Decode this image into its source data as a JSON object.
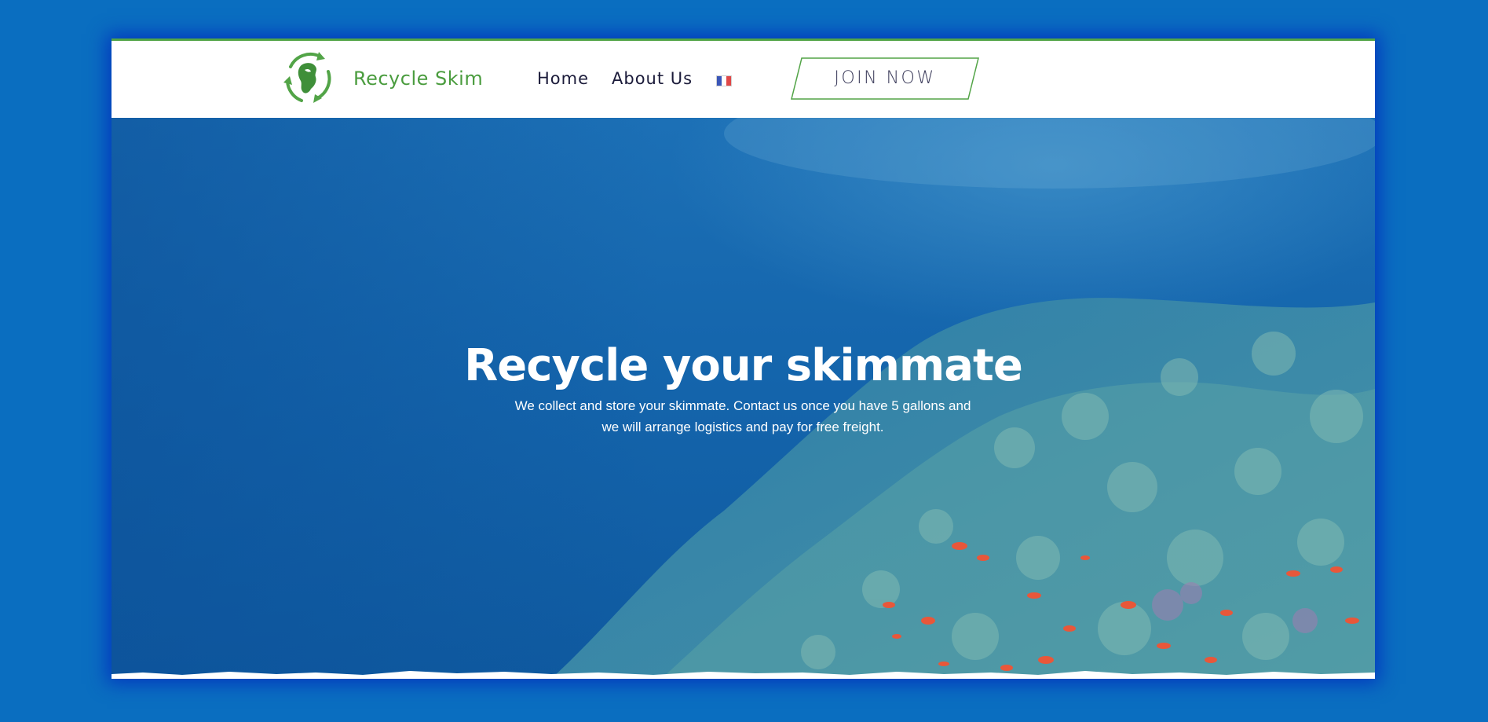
{
  "header": {
    "brand": "Recycle Skim",
    "nav": {
      "home": "Home",
      "about": "About Us"
    },
    "language_icon": "french-flag-icon",
    "join_button": "JOIN NOW"
  },
  "hero": {
    "title": "Recycle your skimmate",
    "subtitle": "We collect and store your skimmate. Contact us once you have 5 gallons and we will arrange logistics and pay for free freight."
  },
  "colors": {
    "page_background": "#0a6ec0",
    "brand_green": "#4a9c3e",
    "nav_text": "#1b1b3a",
    "hero_water": "#1566ad",
    "reef": "#3f8fa6",
    "fish": "#e8573a"
  }
}
